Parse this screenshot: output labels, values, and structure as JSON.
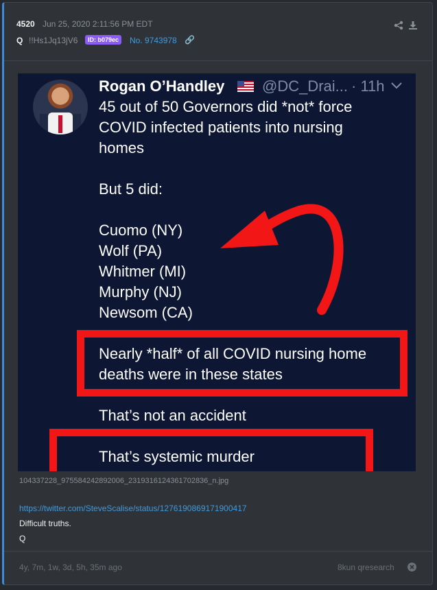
{
  "post": {
    "number": "4520",
    "date": "Jun 25, 2020 2:11:56 PM EDT",
    "author_letter": "Q",
    "tripcode": "!!Hs1Jq13jV6",
    "id_badge": "ID: b079ec",
    "post_link": "No. 9743978",
    "link_icon": "link-icon",
    "share_icon": "share-icon",
    "download_icon": "download-icon"
  },
  "tweet": {
    "name": "Rogan O’Handley",
    "flag_icon": "us-flag-icon",
    "handle": "@DC_Drai...",
    "time": "· 11h",
    "lines": [
      "45 out of 50 Governors did *not* force",
      "COVID infected patients into nursing",
      "homes",
      "But 5 did:",
      "Cuomo (NY)",
      "Wolf (PA)",
      "Whitmer (MI)",
      "Murphy (NJ)",
      "Newsom (CA)",
      "Nearly *half* of all COVID nursing home",
      "deaths were in these states",
      "That’s not an accident",
      "That’s systemic murder"
    ],
    "highlight_color": "#f21616",
    "background_color": "#0d1733"
  },
  "image_filename": "104337228_975584242892006_2319316124361702836_n.jpg",
  "url": "https://twitter.com/SteveScalise/status/1276190869171900417",
  "message": "Difficult truths.",
  "signature": "Q",
  "footer": {
    "relative_time": "4y, 7m, 1w, 3d, 5h, 35m ago",
    "board": "8kun qresearch",
    "close_icon": "close-circle-icon"
  },
  "colors": {
    "accent": "#3d9be0",
    "badge": "#8b5cf6",
    "card": "#2f3338"
  }
}
